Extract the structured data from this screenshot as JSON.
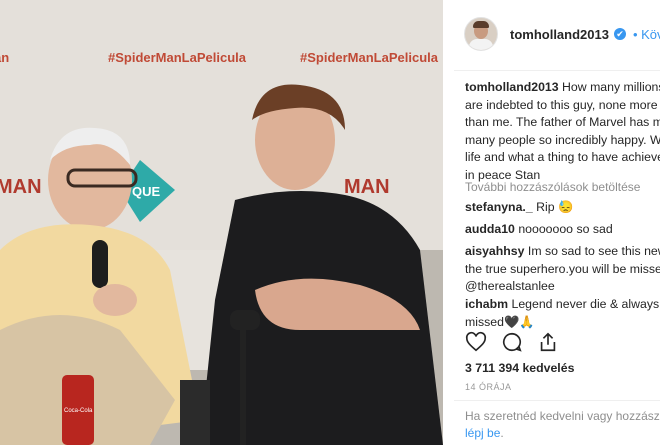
{
  "post": {
    "banner_text": "#SpiderManLaPelicula",
    "banner_fragment_left": "an",
    "banner_fragment_right": "MAN",
    "banner_fragment_left2": "MAN",
    "logo_fragment": "QUE",
    "can_label": "Coca-Cola"
  },
  "header": {
    "username": "tomholland2013",
    "verified_glyph": "✔",
    "follow_label": "Követés"
  },
  "caption": {
    "username": "tomholland2013",
    "lines": [
      "How many millions",
      "are indebted to this guy, none more",
      "than me. The father of Marvel has m",
      "many people so incredibly happy. W",
      "life and what a thing to have achieve",
      "in peace Stan"
    ]
  },
  "load_more": "További hozzászólások betöltése",
  "comments": [
    {
      "user": "stefanyna._",
      "lines": [
        "Rip 😓"
      ]
    },
    {
      "user": "audda10",
      "lines": [
        "nooooooo so sad"
      ]
    },
    {
      "user": "aisyahhsy",
      "lines": [
        "Im so sad to see this news",
        "the true superhero.you will be misse",
        "@therealstanlee"
      ]
    },
    {
      "user": "ichabm",
      "lines": [
        "Legend never die & always b",
        "missed🖤🙏"
      ]
    }
  ],
  "actions": {
    "like_icon": "heart-icon",
    "comment_icon": "comment-icon",
    "share_icon": "share-icon"
  },
  "likes_text": "3 711 394 kedvelés",
  "time_text": "14 ÓRÁJA",
  "login": {
    "line1": "Ha szeretnéd kedvelni vagy hozzász",
    "link": "lépj be",
    "line2_suffix": "."
  }
}
